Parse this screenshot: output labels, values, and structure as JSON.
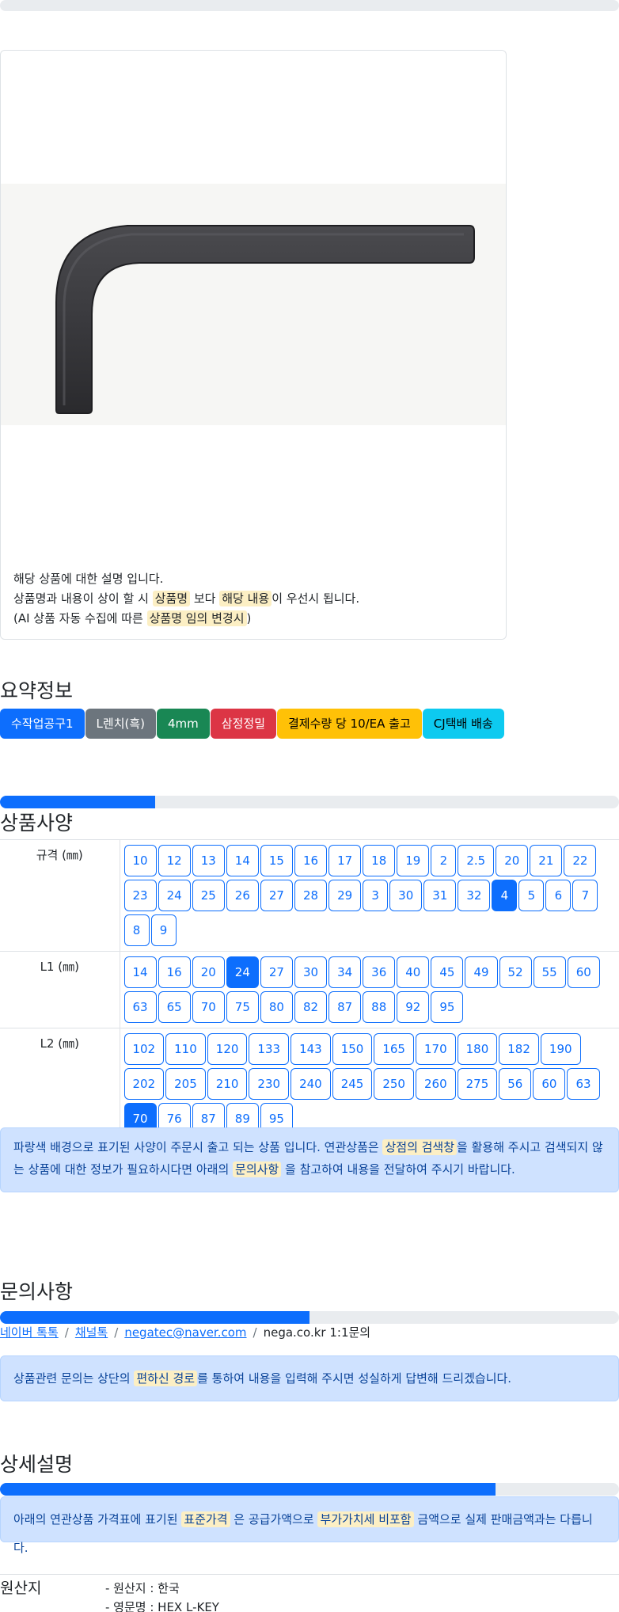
{
  "product": {
    "description_line1": "해당 상품에 대한 설명 입니다.",
    "description_line2_a": "상품명과 내용이 상이 할 시",
    "description_line2_mark1": "상품명",
    "description_line2_b": "보다",
    "description_line2_mark2": "해당 내용",
    "description_line2_c": "이 우선시 됩니다.",
    "description_line3_a": "(AI 상품 자동 수집에 따른",
    "description_line3_mark": "상품명 임의 변경시",
    "description_line3_b": ")"
  },
  "summary": {
    "title": "요약정보",
    "badges": [
      {
        "label": "수작업공구1",
        "color": "#0d6efd",
        "text_color": "#ffffff"
      },
      {
        "label": "L렌치(흑)",
        "color": "#6c757d",
        "text_color": "#ffffff"
      },
      {
        "label": "4mm",
        "color": "#198754",
        "text_color": "#ffffff"
      },
      {
        "label": "삼정정밀",
        "color": "#dc3545",
        "text_color": "#ffffff"
      },
      {
        "label": "결제수량 당 10/EA 출고",
        "color": "#ffc107",
        "text_color": "#000000"
      },
      {
        "label": "CJ택배 배송",
        "color": "#0dcaf0",
        "text_color": "#000000"
      }
    ]
  },
  "spec": {
    "title": "상품사양",
    "progress": 0.25,
    "rows": [
      {
        "label": "규격 (㎜)",
        "values": [
          "10",
          "12",
          "13",
          "14",
          "15",
          "16",
          "17",
          "18",
          "19",
          "2",
          "2.5",
          "20",
          "21",
          "22",
          "23",
          "24",
          "25",
          "26",
          "27",
          "28",
          "29",
          "3",
          "30",
          "31",
          "32",
          "4",
          "5",
          "6",
          "7",
          "8",
          "9"
        ],
        "active": "4"
      },
      {
        "label": "L1 (㎜)",
        "values": [
          "14",
          "16",
          "20",
          "24",
          "27",
          "30",
          "34",
          "36",
          "40",
          "45",
          "49",
          "52",
          "55",
          "60",
          "63",
          "65",
          "70",
          "75",
          "80",
          "82",
          "87",
          "88",
          "92",
          "95"
        ],
        "active": "24"
      },
      {
        "label": "L2 (㎜)",
        "values": [
          "102",
          "110",
          "120",
          "133",
          "143",
          "150",
          "165",
          "170",
          "180",
          "182",
          "190",
          "202",
          "205",
          "210",
          "230",
          "240",
          "245",
          "250",
          "260",
          "275",
          "56",
          "60",
          "63",
          "70",
          "76",
          "87",
          "89",
          "95"
        ],
        "active": "70"
      }
    ],
    "notice_a": "파랑색 배경으로 표기된 사양이 주문시 출고 되는 상품 입니다. 연관상품은",
    "notice_mark1": "상점의 검색창",
    "notice_b": "을 활용해 주시고 검색되지 않는 상품에 대한 정보가 필요하시다면 아래의",
    "notice_mark2": "문의사항",
    "notice_c": "을 참고하여 내용을 전달하여 주시기 바랍니다."
  },
  "inquiry": {
    "title": "문의사항",
    "progress": 0.5,
    "links": [
      "네이버 톡톡",
      "채널톡",
      "negatec@naver.com"
    ],
    "last": "nega.co.kr 1:1문의",
    "sep": "/",
    "notice_a": "상품관련 문의는 상단의",
    "notice_mark": "편하신 경로",
    "notice_b": "를 통하여 내용을 입력해 주시면 성실하게 답변해 드리겠습니다."
  },
  "detail": {
    "title": "상세설명",
    "progress": 0.8,
    "notice_a": "아래의 연관상품 가격표에 표기된",
    "notice_mark1": "표준가격",
    "notice_b": "은 공급가액으로",
    "notice_mark2": "부가가치세 비포함",
    "notice_c": "금액으로 실제 판매금액과는 다릅니다."
  },
  "origin": {
    "label": "원산지",
    "items": [
      "- 원산지 : 한국",
      "- 영문명 : HEX L-KEY"
    ]
  }
}
